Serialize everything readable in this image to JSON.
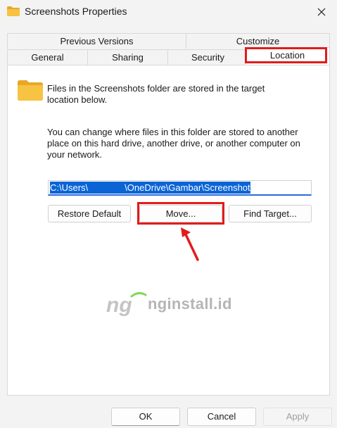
{
  "window": {
    "title": "Screenshots Properties"
  },
  "tabs": {
    "row1": [
      {
        "label": "Previous Versions"
      },
      {
        "label": "Customize"
      }
    ],
    "row2": [
      {
        "label": "General"
      },
      {
        "label": "Sharing"
      },
      {
        "label": "Security"
      },
      {
        "label": "Location",
        "selected": true
      }
    ]
  },
  "content": {
    "description_1": "Files in the Screenshots folder are stored in the target location below.",
    "description_2": "You can change where files in this folder are stored to another place on this hard drive, another drive, or another computer on your network.",
    "path_prefix": "C:\\Users\\",
    "path_suffix": "\\OneDrive\\Gambar\\Screenshot",
    "restore_default_label": "Restore Default",
    "move_label": "Move...",
    "find_target_label": "Find Target..."
  },
  "watermark": {
    "text": "nginstall.id"
  },
  "footer": {
    "ok_label": "OK",
    "cancel_label": "Cancel",
    "apply_label": "Apply"
  },
  "colors": {
    "highlight": "#e31b1b",
    "selection": "#0a64d6",
    "folder": "#f6c343"
  }
}
